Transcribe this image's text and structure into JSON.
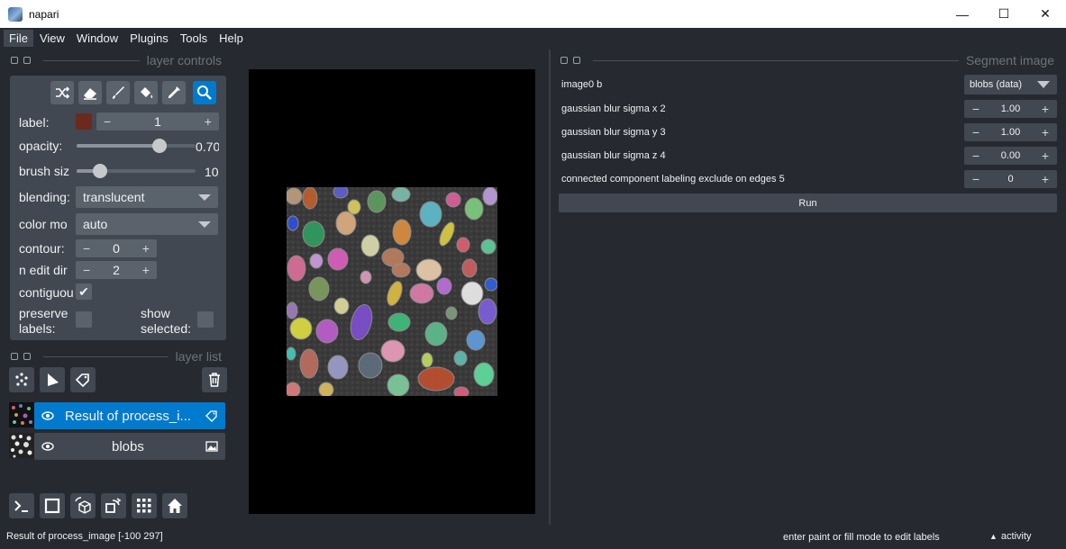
{
  "window": {
    "title": "napari",
    "minimize": "—",
    "maximize": "☐",
    "close": "✕"
  },
  "menu": [
    "File",
    "View",
    "Window",
    "Plugins",
    "Tools",
    "Help"
  ],
  "layer_controls": {
    "title": "layer controls",
    "label_label": "label:",
    "label_value": "1",
    "label_color": "#6b2a1c",
    "opacity_label": "opacity:",
    "opacity_value": "0.70",
    "opacity_fraction": 0.7,
    "brush_label": "brush siz",
    "brush_value": "10",
    "brush_fraction": 0.2,
    "blending_label": "blending:",
    "blending_value": "translucent",
    "colormode_label": "color mo",
    "colormode_value": "auto",
    "contour_label": "contour:",
    "contour_value": "0",
    "nedit_label": "n edit dir",
    "nedit_value": "2",
    "contiguous_label": "contiguou",
    "contiguous_checked": true,
    "preserve_label_1": "preserve",
    "preserve_label_2": "labels:",
    "show_label_1": "show",
    "show_label_2": "selected:",
    "minus": "−",
    "plus": "+",
    "check": "✔"
  },
  "layer_list": {
    "title": "layer list",
    "layers": [
      {
        "name": "Result of process_i...",
        "selected": true,
        "type": "labels"
      },
      {
        "name": "blobs",
        "selected": false,
        "type": "image"
      }
    ]
  },
  "widget": {
    "title": "Segment image",
    "image_label": "image0 b",
    "image_value": "blobs (data)",
    "params": [
      {
        "label": "gaussian blur sigma x 2",
        "value": "1.00"
      },
      {
        "label": "gaussian blur sigma y 3",
        "value": "1.00"
      },
      {
        "label": "gaussian blur sigma z 4",
        "value": "0.00"
      },
      {
        "label": "connected component labeling exclude on edges 5",
        "value": "0"
      }
    ],
    "run_label": "Run"
  },
  "status": {
    "left": "Result of process_image [-100  297]",
    "middle": "enter paint or fill mode to edit labels",
    "activity": "activity",
    "activity_arrow": "▲"
  }
}
